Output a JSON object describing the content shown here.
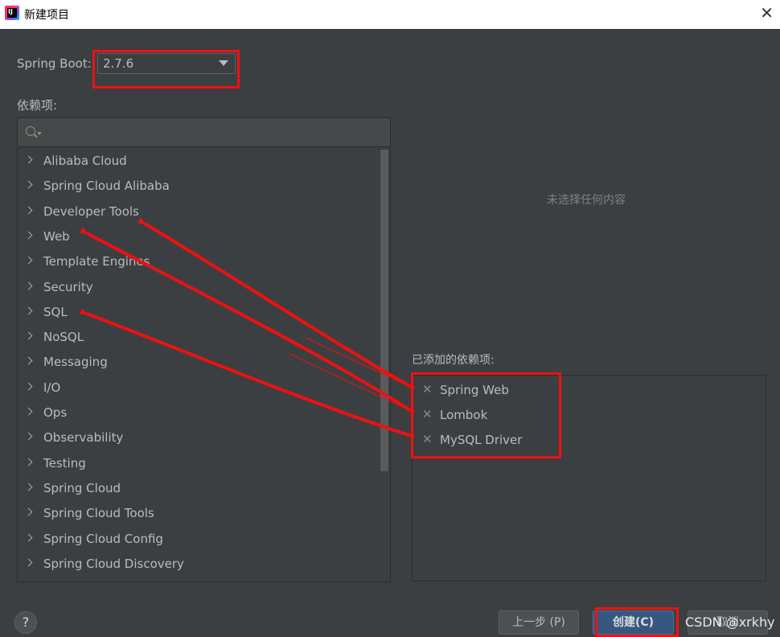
{
  "window": {
    "title": "新建项目",
    "close_symbol": "✕"
  },
  "spring_boot": {
    "label": "Spring Boot:",
    "version": "2.7.6"
  },
  "dependencies": {
    "label": "依赖项:",
    "search_placeholder": "",
    "categories": [
      "Alibaba Cloud",
      "Spring Cloud Alibaba",
      "Developer Tools",
      "Web",
      "Template Engines",
      "Security",
      "SQL",
      "NoSQL",
      "Messaging",
      "I/O",
      "Ops",
      "Observability",
      "Testing",
      "Spring Cloud",
      "Spring Cloud Tools",
      "Spring Cloud Config",
      "Spring Cloud Discovery"
    ]
  },
  "detail": {
    "empty_message": "未选择任何内容"
  },
  "added": {
    "label": "已添加的依赖项:",
    "items": [
      "Spring Web",
      "Lombok",
      "MySQL Driver"
    ],
    "remove_symbol": "✕"
  },
  "footer": {
    "help": "?",
    "prev": "上一步 (P)",
    "create": "创建(C)",
    "cancel": "取消"
  },
  "watermark": "CSDN @xrkhy",
  "colors": {
    "annotation": "#ee1111",
    "primary_button": "#365880"
  }
}
